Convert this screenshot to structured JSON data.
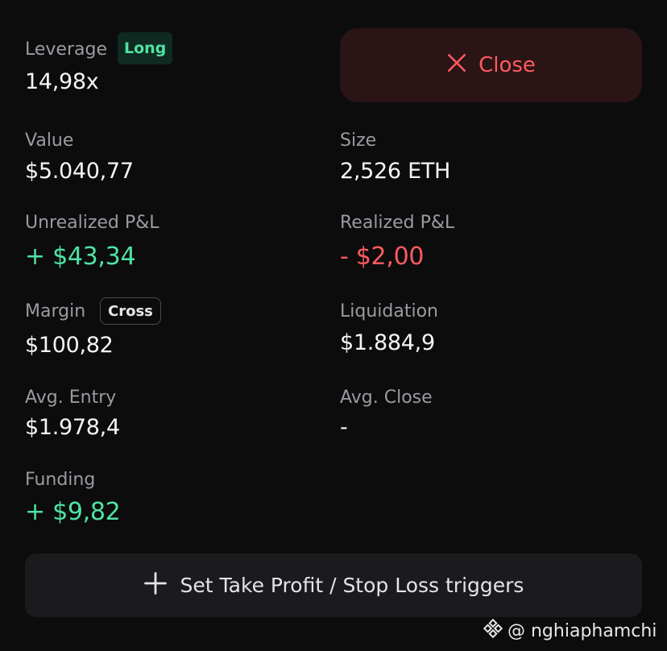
{
  "leverage": {
    "label": "Leverage",
    "badge": "Long",
    "value": "14,98x"
  },
  "close_button": {
    "label": "Close",
    "icon": "close-icon"
  },
  "value": {
    "label": "Value",
    "value": "$5.040,77"
  },
  "size": {
    "label": "Size",
    "value": "2,526 ETH"
  },
  "unrealized_pnl": {
    "label": "Unrealized P&L",
    "value": "+ $43,34",
    "color": "#4ee3a3"
  },
  "realized_pnl": {
    "label": "Realized P&L",
    "value": "- $2,00",
    "color": "#ff5a5f"
  },
  "margin": {
    "label": "Margin",
    "badge": "Cross",
    "value": "$100,82"
  },
  "liquidation": {
    "label": "Liquidation",
    "value": "$1.884,9"
  },
  "avg_entry": {
    "label": "Avg. Entry",
    "value": "$1.978,4"
  },
  "avg_close": {
    "label": "Avg. Close",
    "value": "-"
  },
  "funding": {
    "label": "Funding",
    "value": "+ $9,82",
    "color": "#4ee3a3"
  },
  "tpsl_button": {
    "label": "Set Take Profit / Stop Loss triggers",
    "icon": "plus-icon"
  },
  "watermark": {
    "handle": "@ nghiaphamchi",
    "icon": "binance-logo-icon"
  }
}
